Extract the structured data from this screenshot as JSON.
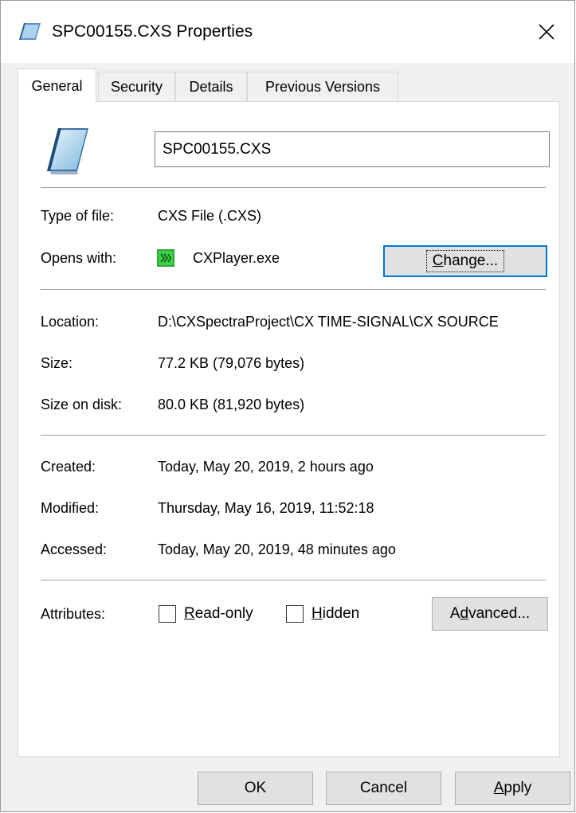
{
  "window": {
    "title": "SPC00155.CXS Properties"
  },
  "tabs": [
    {
      "label": "General",
      "active": true
    },
    {
      "label": "Security",
      "active": false
    },
    {
      "label": "Details",
      "active": false
    },
    {
      "label": "Previous Versions",
      "active": false
    }
  ],
  "general": {
    "file_name": "SPC00155.CXS",
    "type_label": "Type of file:",
    "type_value": "CXS File (.CXS)",
    "opens_label": "Opens with:",
    "opens_value": "CXPlayer.exe",
    "change_button": {
      "accel": "C",
      "rest": "hange..."
    },
    "location_label": "Location:",
    "location_value": "D:\\CXSpectraProject\\CX TIME-SIGNAL\\CX SOURCE",
    "size_label": "Size:",
    "size_value": "77.2 KB (79,076 bytes)",
    "size_disk_label": "Size on disk:",
    "size_disk_value": "80.0 KB (81,920 bytes)",
    "created_label": "Created:",
    "created_value": "Today, May 20, 2019, 2 hours ago",
    "modified_label": "Modified:",
    "modified_value": "Thursday, May 16, 2019, 11:52:18",
    "accessed_label": "Accessed:",
    "accessed_value": "Today, May 20, 2019, 48 minutes ago",
    "attributes_label": "Attributes:",
    "readonly": {
      "accel": "R",
      "rest": "ead-only",
      "checked": false
    },
    "hidden": {
      "accel": "H",
      "rest": "idden",
      "checked": false
    },
    "advanced_button": {
      "pre": "A",
      "accel": "d",
      "rest": "vanced..."
    }
  },
  "buttons": {
    "ok": "OK",
    "cancel": "Cancel",
    "apply": {
      "accel": "A",
      "rest": "pply"
    }
  },
  "colors": {
    "focus_border": "#0078d7",
    "button_face": "#e1e1e1",
    "dialog_bg": "#f0f0f0"
  }
}
